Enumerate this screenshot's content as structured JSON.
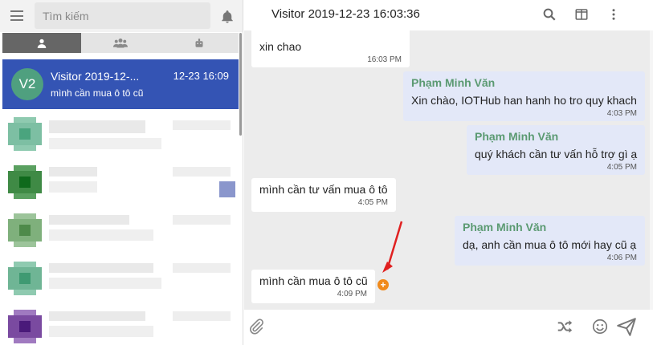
{
  "search": {
    "placeholder": "Tìm kiếm"
  },
  "tabs": [
    "single-user-icon",
    "group-users-icon",
    "bot-icon"
  ],
  "conversation_list": [
    {
      "avatar": "V2",
      "name": "Visitor 2019-12-...",
      "time": "12-23 16:09",
      "preview": "mình cần mua ô tô cũ",
      "active": true
    }
  ],
  "chat": {
    "title": "Visitor 2019-12-23 16:03:36",
    "messages": [
      {
        "direction": "in",
        "text": "xin chao",
        "time": "16:03 PM"
      },
      {
        "direction": "out",
        "sender": "Phạm Minh Văn",
        "text": "Xin chào, IOTHub han hanh ho tro quy khach",
        "time": "4:03 PM"
      },
      {
        "direction": "out",
        "sender": "Phạm Minh Văn",
        "text": "quý khách cần tư vấn hỗ trợ gì ạ",
        "time": "4:05 PM"
      },
      {
        "direction": "in",
        "text": "mình cần tư vấn mua ô tô",
        "time": "4:05 PM"
      },
      {
        "direction": "out",
        "sender": "Phạm Minh Văn",
        "text": "dạ, anh cần mua ô tô mới hay cũ ạ",
        "time": "4:06 PM"
      },
      {
        "direction": "in",
        "text": "mình cần mua ô tô cũ",
        "time": "4:09 PM"
      }
    ]
  },
  "colors": {
    "accent": "#3454b4",
    "avatar": "#4fa07f",
    "sender": "#5b9a72",
    "out_bubble": "#e3e8f8",
    "annotation": "#e02020",
    "plus": "#f08a1c"
  }
}
